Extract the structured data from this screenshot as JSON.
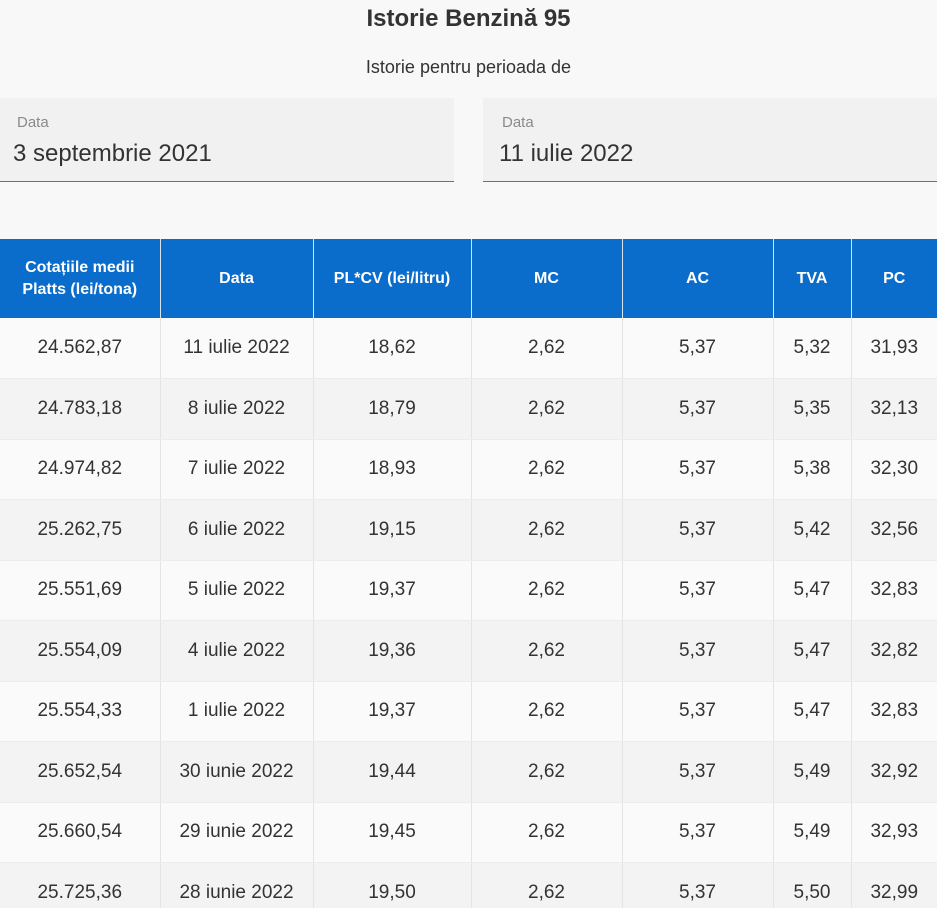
{
  "header": {
    "title": "Istorie Benzină 95",
    "subtitle": "Istorie pentru perioada de"
  },
  "date_range": {
    "from": {
      "label": "Data",
      "value": "3 septembrie 2021"
    },
    "to": {
      "label": "Data",
      "value": "11 iulie 2022"
    }
  },
  "table": {
    "columns": [
      "Cotațiile medii Platts (lei/tona)",
      "Data",
      "PL*CV (lei/litru)",
      "MC",
      "AC",
      "TVA",
      "PC"
    ],
    "rows": [
      [
        "24.562,87",
        "11 iulie 2022",
        "18,62",
        "2,62",
        "5,37",
        "5,32",
        "31,93"
      ],
      [
        "24.783,18",
        "8 iulie 2022",
        "18,79",
        "2,62",
        "5,37",
        "5,35",
        "32,13"
      ],
      [
        "24.974,82",
        "7 iulie 2022",
        "18,93",
        "2,62",
        "5,37",
        "5,38",
        "32,30"
      ],
      [
        "25.262,75",
        "6 iulie 2022",
        "19,15",
        "2,62",
        "5,37",
        "5,42",
        "32,56"
      ],
      [
        "25.551,69",
        "5 iulie 2022",
        "19,37",
        "2,62",
        "5,37",
        "5,47",
        "32,83"
      ],
      [
        "25.554,09",
        "4 iulie 2022",
        "19,36",
        "2,62",
        "5,37",
        "5,47",
        "32,82"
      ],
      [
        "25.554,33",
        "1 iulie 2022",
        "19,37",
        "2,62",
        "5,37",
        "5,47",
        "32,83"
      ],
      [
        "25.652,54",
        "30 iunie 2022",
        "19,44",
        "2,62",
        "5,37",
        "5,49",
        "32,92"
      ],
      [
        "25.660,54",
        "29 iunie 2022",
        "19,45",
        "2,62",
        "5,37",
        "5,49",
        "32,93"
      ],
      [
        "25.725,36",
        "28 iunie 2022",
        "19,50",
        "2,62",
        "5,37",
        "5,50",
        "32,99"
      ]
    ]
  },
  "colors": {
    "header_bg": "#0a6ccb",
    "page_bg": "#f8f8f8",
    "field_bg": "#f1f1f1",
    "field_underline": "#4d7a99"
  }
}
